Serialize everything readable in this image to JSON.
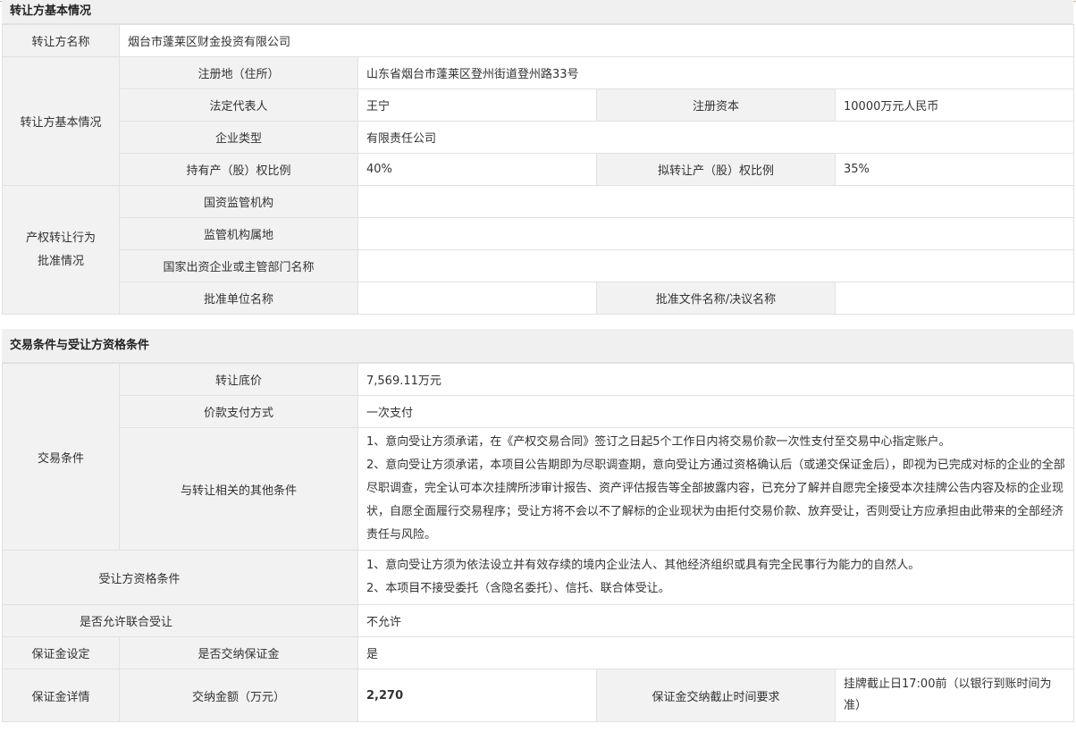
{
  "section1": {
    "title": "转让方基本情况",
    "transferor_name_label": "转让方名称",
    "transferor_name": "烟台市蓬莱区财金投资有限公司",
    "basic_label": "转让方基本情况",
    "address_label": "注册地（住所）",
    "address": "山东省烟台市蓬莱区登州街道登州路33号",
    "legal_rep_label": "法定代表人",
    "legal_rep": "王宁",
    "capital_label": "注册资本",
    "capital": "10000万元人民币",
    "company_type_label": "企业类型",
    "company_type": "有限责任公司",
    "holding_ratio_label": "持有产（股）权比例",
    "holding_ratio": "40%",
    "transfer_ratio_label": "拟转让产（股）权比例",
    "transfer_ratio": "35%",
    "approval_label_1": "产权转让行为",
    "approval_label_2": "批准情况",
    "regulator_label": "国资监管机构",
    "regulator": "",
    "regulator_location_label": "监管机构属地",
    "regulator_location": "",
    "supervisor_label": "国家出资企业或主管部门名称",
    "supervisor": "",
    "approval_unit_label": "批准单位名称",
    "approval_unit": "",
    "approval_doc_label": "批准文件名称/决议名称",
    "approval_doc": ""
  },
  "section2": {
    "title": "交易条件与受让方资格条件",
    "trade_conditions_label": "交易条件",
    "base_price_label": "转让底价",
    "base_price": "7,569.11万元",
    "payment_label": "价款支付方式",
    "payment": "一次支付",
    "other_conditions_label": "与转让相关的其他条件",
    "other_conditions_1": "1、意向受让方须承诺，在《产权交易合同》签订之日起5个工作日内将交易价款一次性支付至交易中心指定账户。",
    "other_conditions_2": "2、意向受让方须承诺，本项目公告期即为尽职调查期，意向受让方通过资格确认后（或递交保证金后），即视为已完成对标的企业的全部尽职调查，完全认可本次挂牌所涉审计报告、资产评估报告等全部披露内容，已充分了解并自愿完全接受本次挂牌公告内容及标的企业现状，自愿全面履行交易程序；受让方将不会以不了解标的企业现状为由拒付交易价款、放弃受让，否则受让方应承担由此带来的全部经济责任与风险。",
    "qualification_label": "受让方资格条件",
    "qualification_1": "1、意向受让方须为依法设立并有效存续的境内企业法人、其他经济组织或具有完全民事行为能力的自然人。",
    "qualification_2": "2、本项目不接受委托（含隐名委托）、信托、联合体受让。",
    "joint_label": "是否允许联合受让",
    "joint": "不允许",
    "deposit_setting_label": "保证金设定",
    "deposit_required_label": "是否交纳保证金",
    "deposit_required": "是",
    "deposit_detail_label": "保证金详情",
    "deposit_amount_label": "交纳金额（万元）",
    "deposit_amount": "2,270",
    "deposit_deadline_label": "保证金交纳截止时间要求",
    "deposit_deadline": "挂牌截止日17:00前（以银行到账时间为准）"
  }
}
